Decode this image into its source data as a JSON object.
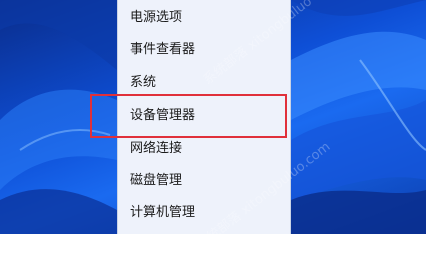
{
  "context_menu": {
    "items": [
      {
        "label": "电源选项"
      },
      {
        "label": "事件查看器"
      },
      {
        "label": "系统"
      },
      {
        "label": "设备管理器"
      },
      {
        "label": "网络连接"
      },
      {
        "label": "磁盘管理"
      },
      {
        "label": "计算机管理"
      }
    ],
    "highlighted_item": "设备管理器",
    "highlight_color": "#e0303a"
  },
  "watermark": {
    "text_top": "系统部落 xitongbuluo",
    "text_bottom": "系统部落 xitongbuluo.com"
  },
  "colors": {
    "menu_background": "#eef2fb",
    "desktop_accent": "#1a6af0"
  }
}
